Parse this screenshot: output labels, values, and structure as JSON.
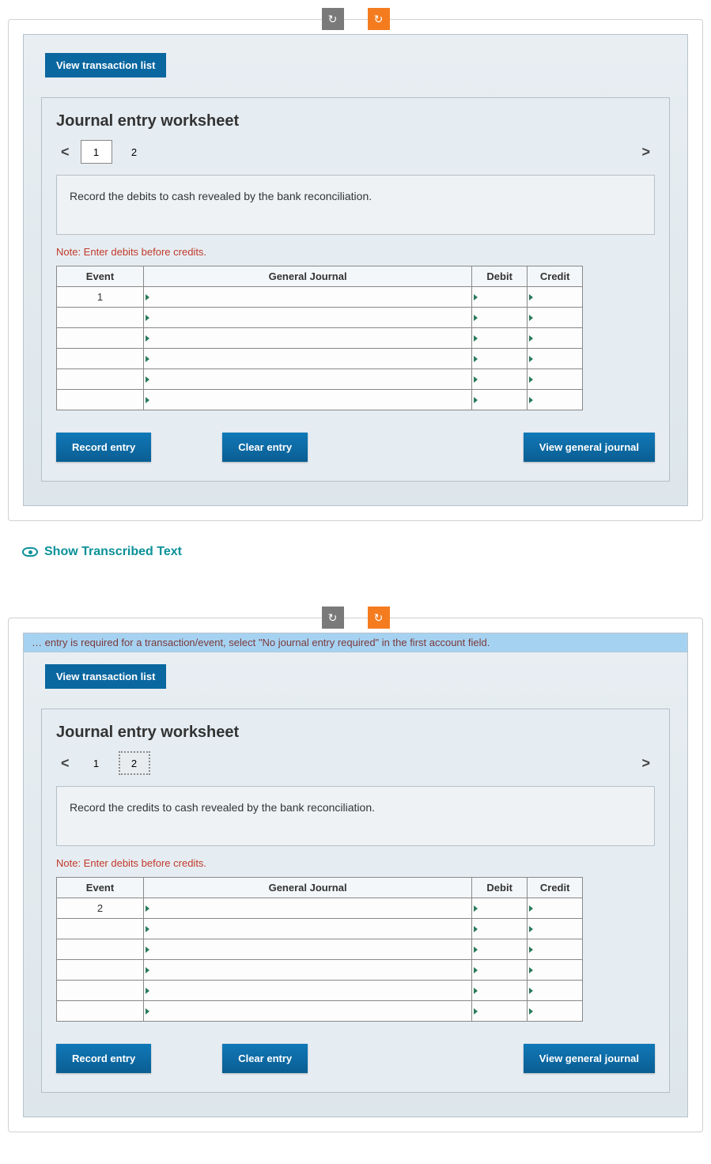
{
  "controls": {
    "refresh_icon": "↻",
    "redo_icon": "↻"
  },
  "worksheet1": {
    "vtl_label": "View transaction list",
    "title": "Journal entry worksheet",
    "pages": [
      "1",
      "2"
    ],
    "active_page": "1",
    "instruction": "Record the debits to cash revealed by the bank reconciliation.",
    "note": "Note: Enter debits before credits.",
    "headers": {
      "event": "Event",
      "journal": "General Journal",
      "debit": "Debit",
      "credit": "Credit"
    },
    "first_event": "1",
    "buttons": {
      "record": "Record entry",
      "clear": "Clear entry",
      "view": "View general journal"
    }
  },
  "show_transcribed": "Show Transcribed Text",
  "worksheet2": {
    "hint": "… entry is required for a transaction/event, select \"No journal entry required\" in the first account field.",
    "vtl_label": "View transaction list",
    "title": "Journal entry worksheet",
    "pages": [
      "1",
      "2"
    ],
    "active_page": "2",
    "instruction": "Record the credits to cash revealed by the bank reconciliation.",
    "note": "Note: Enter debits before credits.",
    "headers": {
      "event": "Event",
      "journal": "General Journal",
      "debit": "Debit",
      "credit": "Credit"
    },
    "first_event": "2",
    "buttons": {
      "record": "Record entry",
      "clear": "Clear entry",
      "view": "View general journal"
    }
  }
}
